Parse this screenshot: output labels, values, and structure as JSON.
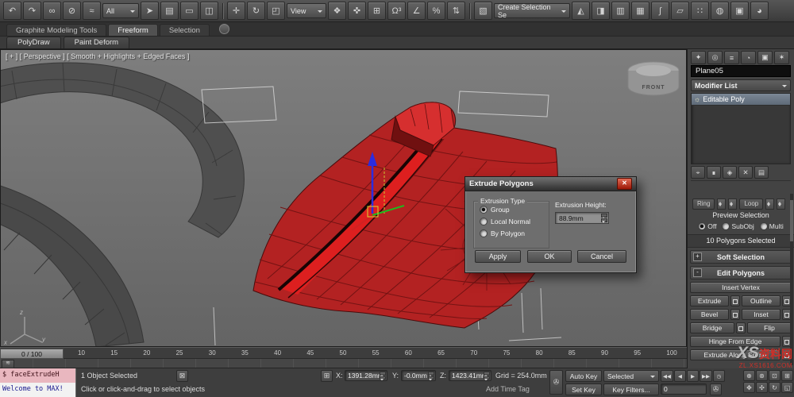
{
  "toolbar": {
    "g1": [
      {
        "name": "undo-icon",
        "glyph": "↶"
      },
      {
        "name": "redo-icon",
        "glyph": "↷"
      },
      {
        "name": "select-link-icon",
        "glyph": "∞"
      },
      {
        "name": "unlink-icon",
        "glyph": "⊘"
      },
      {
        "name": "bind-spacewarp-icon",
        "glyph": "≈"
      }
    ],
    "selection_filter": "All",
    "g2": [
      {
        "name": "select-object-icon",
        "glyph": "➤"
      },
      {
        "name": "select-by-name-icon",
        "glyph": "▤"
      },
      {
        "name": "rect-select-icon",
        "glyph": "▭"
      },
      {
        "name": "window-crossing-icon",
        "glyph": "◫"
      }
    ],
    "g3": [
      {
        "name": "select-move-icon",
        "glyph": "✛"
      },
      {
        "name": "select-rotate-icon",
        "glyph": "↻"
      },
      {
        "name": "select-scale-icon",
        "glyph": "◰"
      }
    ],
    "coordsys": "View",
    "g4": [
      {
        "name": "pivot-center-icon",
        "glyph": "❖"
      },
      {
        "name": "select-manipulate-icon",
        "glyph": "✜"
      },
      {
        "name": "keyboard-override-icon",
        "glyph": "⊞"
      },
      {
        "name": "snap-toggle-icon",
        "glyph": "Ω³"
      },
      {
        "name": "angle-snap-icon",
        "glyph": "∠"
      },
      {
        "name": "percent-snap-icon",
        "glyph": "%"
      },
      {
        "name": "spinner-snap-icon",
        "glyph": "⇅"
      }
    ],
    "g5": [
      {
        "name": "named-sets-icon",
        "glyph": "▧"
      }
    ],
    "named_sets": "Create Selection Se",
    "g6": [
      {
        "name": "mirror-icon",
        "glyph": "◭"
      },
      {
        "name": "align-icon",
        "glyph": "◨"
      },
      {
        "name": "layer-manager-icon",
        "glyph": "▥"
      },
      {
        "name": "graphite-toggle-icon",
        "glyph": "▦"
      },
      {
        "name": "curve-editor-icon",
        "glyph": "∫"
      },
      {
        "name": "schematic-view-icon",
        "glyph": "▱"
      },
      {
        "name": "material-editor-icon",
        "glyph": "∷"
      },
      {
        "name": "render-setup-icon",
        "glyph": "◍"
      },
      {
        "name": "rendered-frame-icon",
        "glyph": "▣"
      },
      {
        "name": "render-production-icon",
        "glyph": "◕"
      }
    ]
  },
  "ribbon": {
    "tab1": "Graphite Modeling Tools",
    "tab2": "Freeform",
    "tab3": "Selection",
    "panel1": "PolyDraw",
    "panel2": "Paint Deform"
  },
  "viewport": {
    "label": "[ + ] [ Perspective ] [ Smooth + Highlights + Edged Faces ]",
    "viewcube": "FRONT",
    "axis_x": "x",
    "axis_y": "y",
    "axis_z": "z"
  },
  "dialog": {
    "title": "Extrude Polygons",
    "close_glyph": "✕",
    "group_title": "Extrusion Type",
    "options": [
      {
        "label": "Group",
        "selected": true
      },
      {
        "label": "Local Normal",
        "selected": false
      },
      {
        "label": "By Polygon",
        "selected": false
      }
    ],
    "height_label": "Extrusion Height:",
    "height_value": "88.9mm",
    "apply_label": "Apply",
    "ok_label": "OK",
    "cancel_label": "Cancel"
  },
  "command_panel": {
    "tabs": [
      {
        "name": "create-tab-icon",
        "glyph": "✦"
      },
      {
        "name": "modify-tab-icon",
        "glyph": "◎"
      },
      {
        "name": "hierarchy-tab-icon",
        "glyph": "≡"
      },
      {
        "name": "motion-tab-icon",
        "glyph": "◔"
      },
      {
        "name": "display-tab-icon",
        "glyph": "▣"
      },
      {
        "name": "utilities-tab-icon",
        "glyph": "✶"
      }
    ],
    "object_name": "Plane05",
    "modifier_list_label": "Modifier List",
    "stack_item": "Editable Poly",
    "stack_icon_glyph": "☼",
    "stack_tools": [
      {
        "name": "pin-stack-icon",
        "glyph": "⌖"
      },
      {
        "name": "show-end-result-icon",
        "glyph": "∎"
      },
      {
        "name": "make-unique-icon",
        "glyph": "◈"
      },
      {
        "name": "remove-modifier-icon",
        "glyph": "✕"
      },
      {
        "name": "configure-sets-icon",
        "glyph": "▤"
      }
    ],
    "ring_label": "Ring",
    "loop_label": "Loop",
    "preview_title": "Preview Selection",
    "preview_options": [
      {
        "label": "Off",
        "selected": true
      },
      {
        "label": "SubObj",
        "selected": false
      },
      {
        "label": "Multi",
        "selected": false
      }
    ],
    "selection_readout": "10 Polygons Selected",
    "soft_selection_label": "Soft Selection",
    "soft_selection_state": "+",
    "edit_polygons_label": "Edit Polygons",
    "edit_polygons_state": "-",
    "buttons": {
      "insert_vertex": "Insert Vertex",
      "extrude": "Extrude",
      "outline": "Outline",
      "bevel": "Bevel",
      "inset": "Inset",
      "bridge": "Bridge",
      "flip": "Flip",
      "hinge": "Hinge From Edge",
      "extrude_spline": "Extrude Along Spline"
    }
  },
  "timeline": {
    "slider_label": "0 / 100",
    "mini_curve_glyph": "≋",
    "ticks": [
      "10",
      "15",
      "20",
      "25",
      "30",
      "35",
      "40",
      "45",
      "50",
      "55",
      "60",
      "65",
      "70",
      "75",
      "80",
      "85",
      "90",
      "95",
      "100"
    ]
  },
  "status_bar": {
    "listener_line1": "$ faceExtrudeH",
    "listener_line2": "Welcome to MAX!",
    "selection_status": "1 Object Selected",
    "lock_glyph": "⊠",
    "abs_glyph": "⊞",
    "x_label": "X:",
    "x_value": "1391.28mm",
    "y_label": "Y:",
    "y_value": "-0.0mm",
    "z_label": "Z:",
    "z_value": "1423.41mm",
    "grid_label": "Grid = 254.0mm",
    "prompt": "Click or click-and-drag to select objects",
    "time_tag": "Add Time Tag",
    "set_keys_glyph": "✇",
    "keymode_glyph": "✇",
    "auto_key": "Auto Key",
    "set_key": "Set Key",
    "selected_dropdown": "Selected",
    "key_filters": "Key Filters...",
    "frame_value": "0",
    "transport": [
      {
        "name": "go-start-button",
        "glyph": "◀◀"
      },
      {
        "name": "prev-frame-button",
        "glyph": "◀"
      },
      {
        "name": "play-button",
        "glyph": "▶"
      },
      {
        "name": "next-frame-button",
        "glyph": "▶▶"
      },
      {
        "name": "time-config-icon",
        "glyph": "◷"
      }
    ],
    "nav": [
      {
        "name": "zoom-icon",
        "glyph": "⊕"
      },
      {
        "name": "zoom-all-icon",
        "glyph": "⊛"
      },
      {
        "name": "zoom-extents-icon",
        "glyph": "⊡"
      },
      {
        "name": "zoom-region-icon",
        "glyph": "⊞"
      },
      {
        "name": "pan-icon",
        "glyph": "✥"
      },
      {
        "name": "walkthrough-icon",
        "glyph": "✣"
      },
      {
        "name": "orbit-icon",
        "glyph": "↻"
      },
      {
        "name": "maximize-viewport-icon",
        "glyph": "◱"
      }
    ]
  },
  "watermark": {
    "prefix": "XS",
    "brand": "资料网",
    "url": "ZL.XS1616.COM"
  }
}
